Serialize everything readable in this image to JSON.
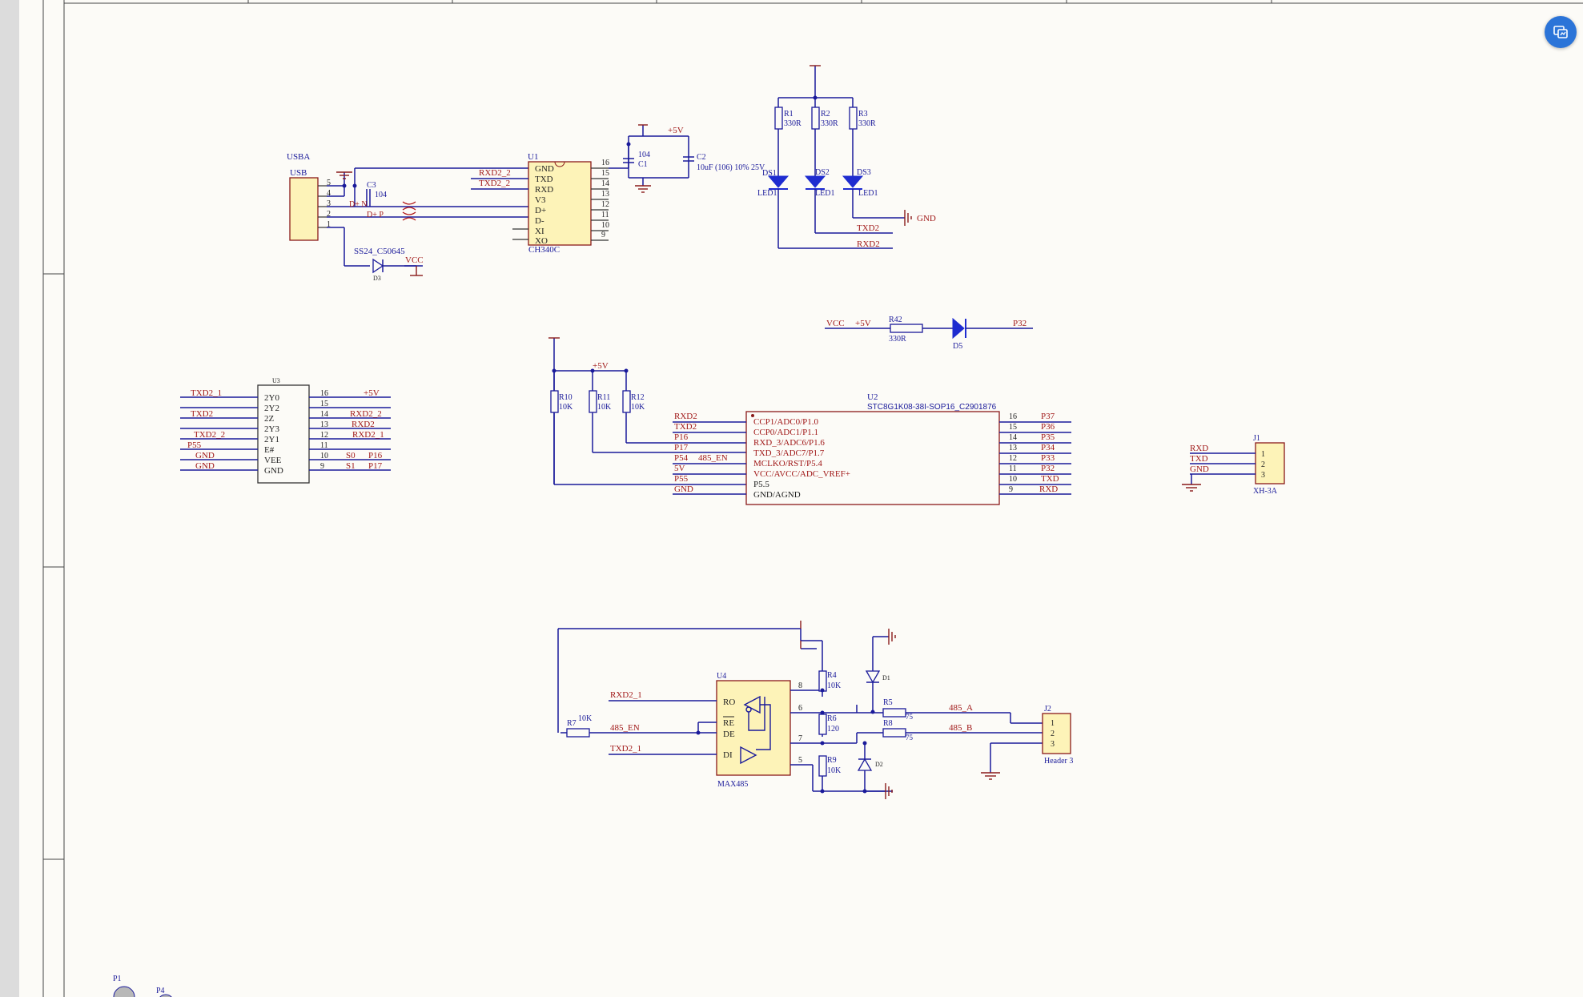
{
  "usb": {
    "ref": "USBA",
    "name": "USB",
    "pins": [
      "5",
      "4",
      "3",
      "2",
      "1"
    ],
    "c3": "C3",
    "c3val": "104",
    "dplus_n": "D+ N",
    "dplus_p": "D+ P",
    "diode": "SS24_C50645",
    "d_ref": "D3",
    "vcc": "VCC"
  },
  "u1": {
    "ref": "U1",
    "part": "CH340C",
    "left_pins": [
      "GND",
      "TXD",
      "RXD",
      "V3",
      "D+",
      "D-",
      "XI",
      "XO"
    ],
    "right_nums": [
      "16",
      "15",
      "14",
      "13",
      "12",
      "11",
      "10",
      "9"
    ],
    "net_txd": "RXD2_2",
    "net_rxd": "TXD2_2"
  },
  "caps": {
    "plus5": "+5V",
    "c1_val": "104",
    "c1_ref": "C1",
    "c2_ref": "C2",
    "c2_val": "10uF (106) 10% 25V"
  },
  "leds": {
    "items": [
      {
        "r": "R1",
        "rv": "330R",
        "ds": "DS1",
        "lab": "LED1"
      },
      {
        "r": "R2",
        "rv": "330R",
        "ds": "DS2",
        "lab": "LED1"
      },
      {
        "r": "R3",
        "rv": "330R",
        "ds": "DS3",
        "lab": "LED1"
      }
    ],
    "gnd": "GND",
    "txd2": "TXD2",
    "rxd2": "RXD2"
  },
  "pwr_led": {
    "vcc": "VCC",
    "p5": "+5V",
    "r": "R42",
    "rv": "330R",
    "d": "D5",
    "net": "P32"
  },
  "u3": {
    "ref": "U3",
    "left_nets": [
      "TXD2_1",
      "",
      "TXD2",
      "",
      "TXD2_2",
      "P55",
      "GND",
      "GND"
    ],
    "pins": [
      "2Y0",
      "2Y2",
      "2Z",
      "2Y3",
      "2Y1",
      "E#",
      "VEE",
      "GND"
    ],
    "nums": [
      "16",
      "15",
      "14",
      "13",
      "12",
      "11",
      "10",
      "9"
    ],
    "right_nets": [
      "+5V",
      "",
      "RXD2_2",
      "RXD2",
      "RXD2_1",
      "",
      "P16",
      "P17"
    ],
    "mid": [
      "",
      "",
      "",
      "",
      "",
      "",
      "S0",
      "S1"
    ]
  },
  "u2": {
    "ref": "U2",
    "part": "STC8G1K08-38I-SOP16_C2901876",
    "left_nets": [
      "RXD2",
      "TXD2",
      "P16",
      "P17",
      "P54",
      "5V",
      "P55",
      "GND"
    ],
    "en": "485_EN",
    "pins": [
      "CCP1/ADC0/P1.0",
      "CCP0/ADC1/P1.1",
      "RXD_3/ADC6/P1.6",
      "TXD_3/ADC7/P1.7",
      "MCLKO/RST/P5.4",
      "VCC/AVCC/ADC_VREF+",
      "P5.5",
      "GND/AGND"
    ],
    "nums": [
      "16",
      "15",
      "14",
      "13",
      "12",
      "11",
      "10",
      "9"
    ],
    "right_nets": [
      "P37",
      "P36",
      "P35",
      "P34",
      "P33",
      "P32",
      "TXD",
      "RXD"
    ],
    "pullups": [
      {
        "r": "R10",
        "v": "10K"
      },
      {
        "r": "R11",
        "v": "10K"
      },
      {
        "r": "R12",
        "v": "10K"
      }
    ],
    "p5": "+5V"
  },
  "j1": {
    "ref": "J1",
    "part": "XH-3A",
    "nets": [
      "RXD",
      "TXD",
      "GND"
    ],
    "pins": [
      "1",
      "2",
      "3"
    ]
  },
  "u4": {
    "ref": "U4",
    "part": "MAX485",
    "pins": [
      "RO",
      "RE",
      "DE",
      "DI"
    ],
    "nums": [
      "8",
      "6",
      "7",
      "5"
    ],
    "nets": [
      "RXD2_1",
      "485_EN",
      "TXD2_1"
    ],
    "r7": "R7",
    "r7v": "10K",
    "r4": "R4",
    "r4v": "10K",
    "r6": "R6",
    "r6v": "120",
    "r9": "R9",
    "r9v": "10K",
    "d1": "D1",
    "d2": "D2",
    "r5": "R5",
    "r5v": "75",
    "r8": "R8",
    "r8v": "75",
    "a": "485_A",
    "b": "485_B"
  },
  "j2": {
    "ref": "J2",
    "part": "Header 3",
    "pins": [
      "1",
      "2",
      "3"
    ]
  },
  "bottom": {
    "p1": "P1",
    "p4": "P4"
  }
}
